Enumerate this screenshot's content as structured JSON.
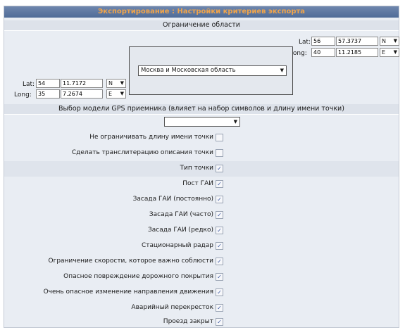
{
  "window": {
    "title": "Экспортирование : Настройки критериев экспорта"
  },
  "area_section": {
    "header": "Ограничение области"
  },
  "top_right": {
    "lat_label": "Lat:",
    "lat_deg": "56",
    "lat_min": "57.3737",
    "lat_dir": "N",
    "long_label": "Long:",
    "long_deg": "40",
    "long_min": "11.2185",
    "long_dir": "E"
  },
  "bottom_left": {
    "lat_label": "Lat:",
    "lat_deg": "54",
    "lat_min": "11.7172",
    "lat_dir": "N",
    "long_label": "Long:",
    "long_deg": "35",
    "long_min": "7.2674",
    "long_dir": "E"
  },
  "region": {
    "selected": "Москва и Московская область"
  },
  "gps_section": {
    "header": "Выбор модели GPS приемника (влияет на набор символов и длину имени точки)",
    "selected": ""
  },
  "options": [
    {
      "label": "Не ограничивать длину имени точки",
      "checked": false
    },
    {
      "label": "Сделать транслитерацию описания точки",
      "checked": false
    }
  ],
  "point_types": {
    "header": {
      "label": "Тип точки",
      "checked": true
    },
    "items": [
      {
        "label": "Пост ГАИ",
        "checked": true
      },
      {
        "label": "Засада ГАИ (постоянно)",
        "checked": true
      },
      {
        "label": "Засада ГАИ (часто)",
        "checked": true
      },
      {
        "label": "Засада ГАИ (редко)",
        "checked": true
      },
      {
        "label": "Стационарный радар",
        "checked": true
      },
      {
        "label": "Ограничение скорости, которое важно соблюсти",
        "checked": true
      },
      {
        "label": "Опасное повреждение дорожного покрытия",
        "checked": true
      },
      {
        "label": "Очень опасное изменение направления движения",
        "checked": true
      },
      {
        "label": "Аварийный перекресток",
        "checked": true
      },
      {
        "label": "Проезд закрыт",
        "checked": true
      }
    ]
  },
  "icons": {
    "dropdown": "chevron-down-icon",
    "check": "checkmark-icon"
  },
  "colors": {
    "title_bg": "#5873a0",
    "title_text": "#f0a44a",
    "panel_bg": "#e9edf3"
  }
}
